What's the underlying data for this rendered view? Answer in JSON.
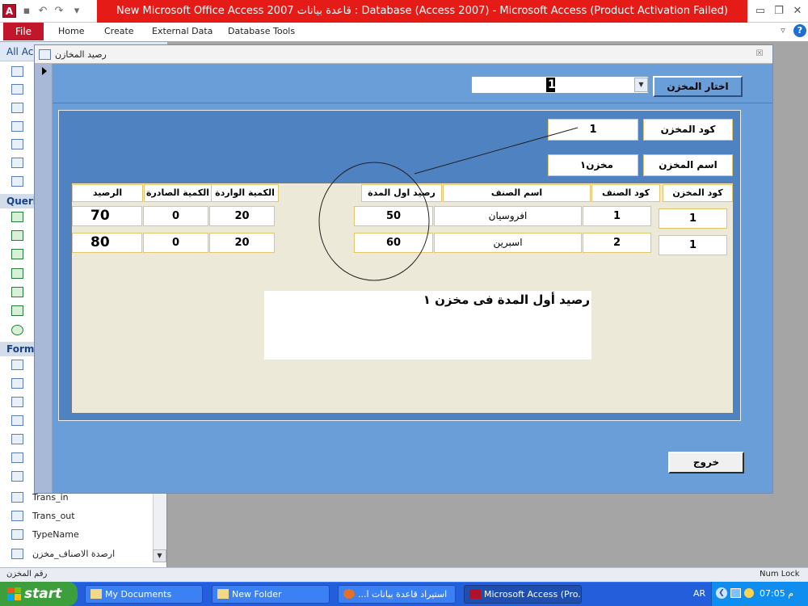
{
  "window": {
    "app_icon": "A",
    "title": "New Microsoft Office Access 2007 قاعدة بيانات : Database (Access 2007)  -  Microsoft Access (Product Activation Failed)",
    "qat_icons": [
      "save-icon",
      "undo-icon",
      "redo-icon",
      "customize-qat-icon"
    ],
    "controls": [
      "minimize-icon",
      "restore-icon",
      "close-icon"
    ]
  },
  "ribbon": {
    "file": "File",
    "tabs": [
      "Home",
      "Create",
      "External Data",
      "Database Tools"
    ],
    "help": "?"
  },
  "nav": {
    "header": "All Ac",
    "groups": {
      "queries": "Queri",
      "forms": "Forms"
    },
    "form_items": [
      "Trans_in",
      "Trans_out",
      "TypeName",
      "ارصدة الاصناف_مخزن"
    ]
  },
  "form": {
    "caption": "رصيد المخازن",
    "close": "☒",
    "select_store_label": "اختار المخزن",
    "combo_value": "1",
    "store_code_label": "كود المخزن",
    "store_code_value": "1",
    "store_name_label": "اسم المخزن",
    "store_name_value": "مخزن١",
    "columns": {
      "store_code": "كود المخزن",
      "item_code": "كود الصنف",
      "item_name": "اسم الصنف",
      "opening_balance": "رصيد اول المدة",
      "qty_in": "الكمية الواردة",
      "qty_out": "الكمية الصادرة",
      "balance": "الرصيد"
    },
    "rows": [
      {
        "store_code": "1",
        "item_code": "1",
        "item_name": "افروسيان",
        "opening_balance": "50",
        "qty_in": "20",
        "qty_out": "0",
        "balance": "70"
      },
      {
        "store_code": "1",
        "item_code": "2",
        "item_name": "اسبرين",
        "opening_balance": "60",
        "qty_in": "20",
        "qty_out": "0",
        "balance": "80"
      }
    ],
    "note": "رصيد أول المدة فى مخزن ١",
    "exit_button": "خروج"
  },
  "status": {
    "left": "رقم المخزن",
    "right": "Num Lock"
  },
  "taskbar": {
    "start": "start",
    "items": [
      "My Documents",
      "New Folder",
      "...استيراد قاعدة بيانات ا",
      "Microsoft Access (Pro..."
    ],
    "lang": "AR",
    "clock": "07:05 م"
  },
  "colors": {
    "title_red": "#e41b17",
    "form_blue": "#6a9ed8",
    "subform_blue": "#4f82c1",
    "field_border": "#e3c56a",
    "taskbar_blue": "#245edb"
  }
}
